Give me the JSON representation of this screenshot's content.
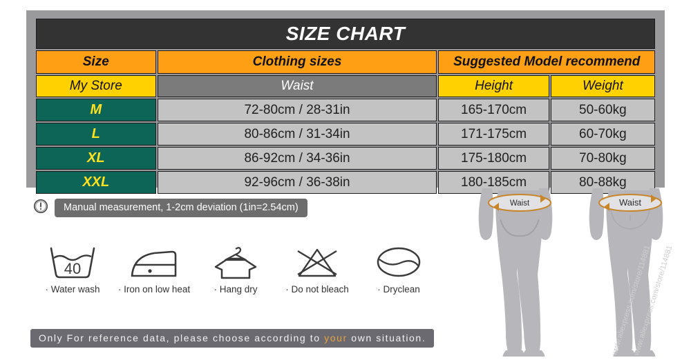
{
  "chart": {
    "title": "SIZE CHART",
    "header_primary": {
      "size": "Size",
      "clothing_sizes": "Clothing sizes",
      "suggested_model": "Suggested Model recommend"
    },
    "header_secondary": {
      "store": "My Store",
      "waist": "Waist",
      "height": "Height",
      "weight": "Weight"
    },
    "rows": [
      {
        "size": "M",
        "waist": "72-80cm / 28-31in",
        "height": "165-170cm",
        "weight": "50-60kg"
      },
      {
        "size": "L",
        "waist": "80-86cm / 31-34in",
        "height": "171-175cm",
        "weight": "60-70kg"
      },
      {
        "size": "XL",
        "waist": "86-92cm / 34-36in",
        "height": "175-180cm",
        "weight": "70-80kg"
      },
      {
        "size": "XXL",
        "waist": "92-96cm / 36-38in",
        "height": "180-185cm",
        "weight": "80-88kg"
      }
    ],
    "colors": {
      "title_bg": "#333333",
      "header_orange": "#FF9F14",
      "header_yellow": "#FFD100",
      "header_gray": "#7b7b7b",
      "size_cell_bg": "#0c6557",
      "size_cell_text": "#FFE21F",
      "data_cell_bg": "#c3c3c3",
      "frame": "#9a9a9c"
    }
  },
  "note": {
    "icon": "exclamation-circle-icon",
    "text": "Manual measurement, 1-2cm deviation (1in=2.54cm)"
  },
  "care_instructions": [
    {
      "icon": "water-wash-icon",
      "label": "· Water wash",
      "temperature": "40"
    },
    {
      "icon": "iron-low-heat-icon",
      "label": "· Iron on low heat",
      "temperature": ""
    },
    {
      "icon": "hang-dry-icon",
      "label": "· Hang dry",
      "temperature": ""
    },
    {
      "icon": "do-not-bleach-icon",
      "label": "· Do not bleach",
      "temperature": ""
    },
    {
      "icon": "dryclean-icon",
      "label": "· Dryclean",
      "temperature": ""
    }
  ],
  "footer": {
    "text_before": "Only For reference data, please choose according to ",
    "highlight": "your",
    "text_after": " own situation."
  },
  "figures": {
    "back_view_label": "Waist",
    "front_view_label": "Waist",
    "watermark": "www.aliexpress.com/store/114881"
  }
}
